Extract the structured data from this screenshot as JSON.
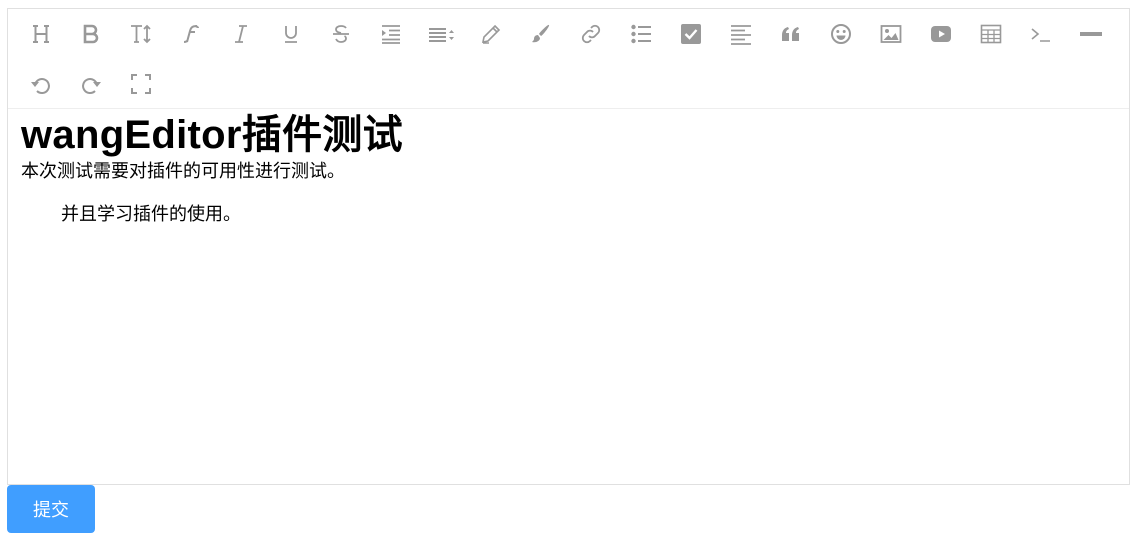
{
  "toolbar": {
    "row1": [
      "heading-icon",
      "bold-icon",
      "font-size-icon",
      "font-family-icon",
      "italic-icon",
      "underline-icon",
      "strikethrough-icon",
      "indent-icon",
      "line-height-icon",
      "font-color-icon",
      "background-color-icon",
      "link-icon",
      "bulleted-list-icon",
      "todo-checkbox-icon",
      "justify-icon",
      "quote-icon",
      "emoticon-icon",
      "image-icon",
      "video-icon",
      "table-icon",
      "code-icon",
      "horizontal-rule-icon"
    ],
    "row2": [
      "undo-icon",
      "redo-icon",
      "fullscreen-icon"
    ],
    "icon_color": "#999999"
  },
  "content": {
    "heading": "wangEditor插件测试",
    "paragraph1": "本次测试需要对插件的可用性进行测试。",
    "paragraph2": "并且学习插件的使用。"
  },
  "submit": {
    "label": "提交",
    "color": "#409eff"
  }
}
